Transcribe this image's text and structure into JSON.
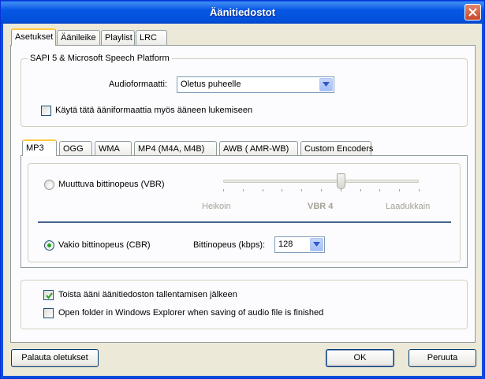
{
  "window": {
    "title": "Äänitiedostot"
  },
  "tabs": [
    "Asetukset",
    "Äänileike",
    "Playlist",
    "LRC"
  ],
  "sapi": {
    "group_title": "SAPI 5 & Microsoft Speech Platform",
    "format_label": "Audioformaatti:",
    "format_value": "Oletus puheelle",
    "use_format_label": "Käytä tätä ääniformaattia myös ääneen lukemiseen",
    "use_format_checked": false
  },
  "format_tabs": [
    "MP3",
    "OGG",
    "WMA",
    "MP4 (M4A, M4B)",
    "AWB ( AMR-WB)",
    "Custom Encoders"
  ],
  "mp3": {
    "vbr_label": "Muuttuva bittinopeus (VBR)",
    "vbr_selected": false,
    "vbr_min_label": "Heikoin",
    "vbr_value_label": "VBR 4",
    "vbr_max_label": "Laadukkain",
    "vbr_level": 0.6,
    "cbr_label": "Vakio bittinopeus (CBR)",
    "cbr_selected": true,
    "bitrate_label": "Bittinopeus (kbps):",
    "bitrate_value": "128"
  },
  "options": {
    "play_after_label": "Toista ääni äänitiedoston tallentamisen jälkeen",
    "play_after_checked": true,
    "open_folder_label": "Open folder in Windows Explorer when saving of audio file is finished",
    "open_folder_checked": false
  },
  "buttons": {
    "reset": "Palauta oletukset",
    "ok": "OK",
    "cancel": "Peruuta"
  }
}
